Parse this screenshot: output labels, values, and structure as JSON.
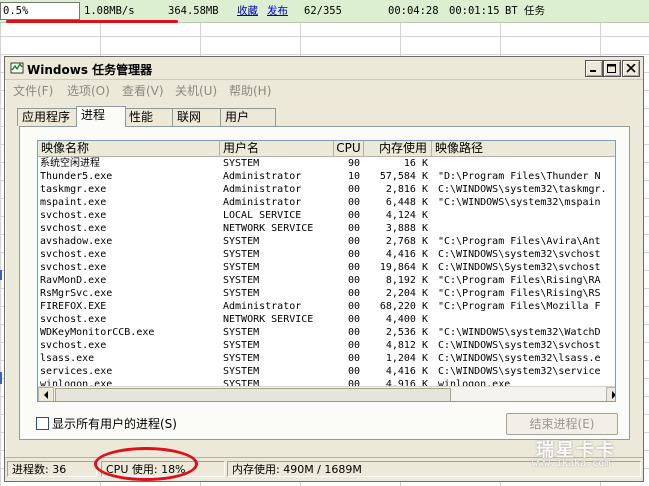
{
  "background_sheet": {
    "percent": "0.5%",
    "speed": "1.08MB/s",
    "size": "364.58MB",
    "link_favorite": "收藏",
    "link_publish": "发布",
    "progress_count": "62/355",
    "time_elapsed": "00:04:28",
    "time_remaining": "00:01:15",
    "task_type": "BT 任务"
  },
  "window": {
    "title": "Windows 任务管理器",
    "menu": [
      "文件(F)",
      "选项(O)",
      "查看(V)",
      "关机(U)",
      "帮助(H)"
    ],
    "tabs": [
      "应用程序",
      "进程",
      "性能",
      "联网",
      "用户"
    ],
    "active_tab": "进程"
  },
  "columns": [
    "映像名称",
    "用户名",
    "CPU",
    "内存使用",
    "映像路径"
  ],
  "processes": [
    {
      "name": "系统空闲进程",
      "user": "SYSTEM",
      "cpu": "90",
      "mem": "16 K",
      "path": ""
    },
    {
      "name": "Thunder5.exe",
      "user": "Administrator",
      "cpu": "10",
      "mem": "57,584 K",
      "path": "\"D:\\Program Files\\Thunder N"
    },
    {
      "name": "taskmgr.exe",
      "user": "Administrator",
      "cpu": "00",
      "mem": "2,816 K",
      "path": "C:\\WINDOWS\\system32\\taskmgr."
    },
    {
      "name": "mspaint.exe",
      "user": "Administrator",
      "cpu": "00",
      "mem": "6,448 K",
      "path": "\"C:\\WINDOWS\\system32\\mspain"
    },
    {
      "name": "svchost.exe",
      "user": "LOCAL SERVICE",
      "cpu": "00",
      "mem": "4,124 K",
      "path": ""
    },
    {
      "name": "svchost.exe",
      "user": "NETWORK SERVICE",
      "cpu": "00",
      "mem": "3,888 K",
      "path": ""
    },
    {
      "name": "avshadow.exe",
      "user": "SYSTEM",
      "cpu": "00",
      "mem": "2,768 K",
      "path": "\"C:\\Program Files\\Avira\\Ant"
    },
    {
      "name": "svchost.exe",
      "user": "SYSTEM",
      "cpu": "00",
      "mem": "4,416 K",
      "path": "C:\\WINDOWS\\system32\\svchost"
    },
    {
      "name": "svchost.exe",
      "user": "SYSTEM",
      "cpu": "00",
      "mem": "19,864 K",
      "path": "C:\\WINDOWS\\System32\\svchost"
    },
    {
      "name": "RavMonD.exe",
      "user": "SYSTEM",
      "cpu": "00",
      "mem": "8,192 K",
      "path": "\"C:\\Program Files\\Rising\\RA"
    },
    {
      "name": "RsMgrSvc.exe",
      "user": "SYSTEM",
      "cpu": "00",
      "mem": "2,204 K",
      "path": "\"C:\\Program Files\\Rising\\RS"
    },
    {
      "name": "FIREFOX.EXE",
      "user": "Administrator",
      "cpu": "00",
      "mem": "68,220 K",
      "path": "\"C:\\Program Files\\Mozilla F"
    },
    {
      "name": "svchost.exe",
      "user": "NETWORK SERVICE",
      "cpu": "00",
      "mem": "4,400 K",
      "path": ""
    },
    {
      "name": "WDKeyMonitorCCB.exe",
      "user": "SYSTEM",
      "cpu": "00",
      "mem": "2,536 K",
      "path": "\"C:\\WINDOWS\\system32\\WatchD"
    },
    {
      "name": "svchost.exe",
      "user": "SYSTEM",
      "cpu": "00",
      "mem": "4,812 K",
      "path": "C:\\WINDOWS\\system32\\svchost"
    },
    {
      "name": "lsass.exe",
      "user": "SYSTEM",
      "cpu": "00",
      "mem": "1,204 K",
      "path": "C:\\WINDOWS\\system32\\lsass.e"
    },
    {
      "name": "services.exe",
      "user": "SYSTEM",
      "cpu": "00",
      "mem": "4,416 K",
      "path": "C:\\WINDOWS\\system32\\service"
    },
    {
      "name": "winlogon.exe",
      "user": "SYSTEM",
      "cpu": "00",
      "mem": "4,916 K",
      "path": "winlogon.exe"
    }
  ],
  "show_all_users_label": "显示所有用户的进程(S)",
  "show_all_users_checked": false,
  "end_process_label": "结束进程(E)",
  "status": {
    "process_count": "进程数: 36",
    "cpu_usage": "CPU 使用: 18%",
    "mem_usage": "内存使用: 490M / 1689M"
  },
  "watermark": {
    "brand": "瑞星卡卡",
    "url": "www.ikaka.com"
  },
  "colors": {
    "highlight_red": "#e0101a",
    "window_face": "#ece9d8",
    "link_blue": "#0000cc"
  },
  "icons": [
    "taskmgr-app-icon",
    "minimize-icon",
    "maximize-icon",
    "close-icon",
    "arrow-up-icon",
    "arrow-down-icon",
    "arrow-left-icon",
    "arrow-right-icon"
  ]
}
